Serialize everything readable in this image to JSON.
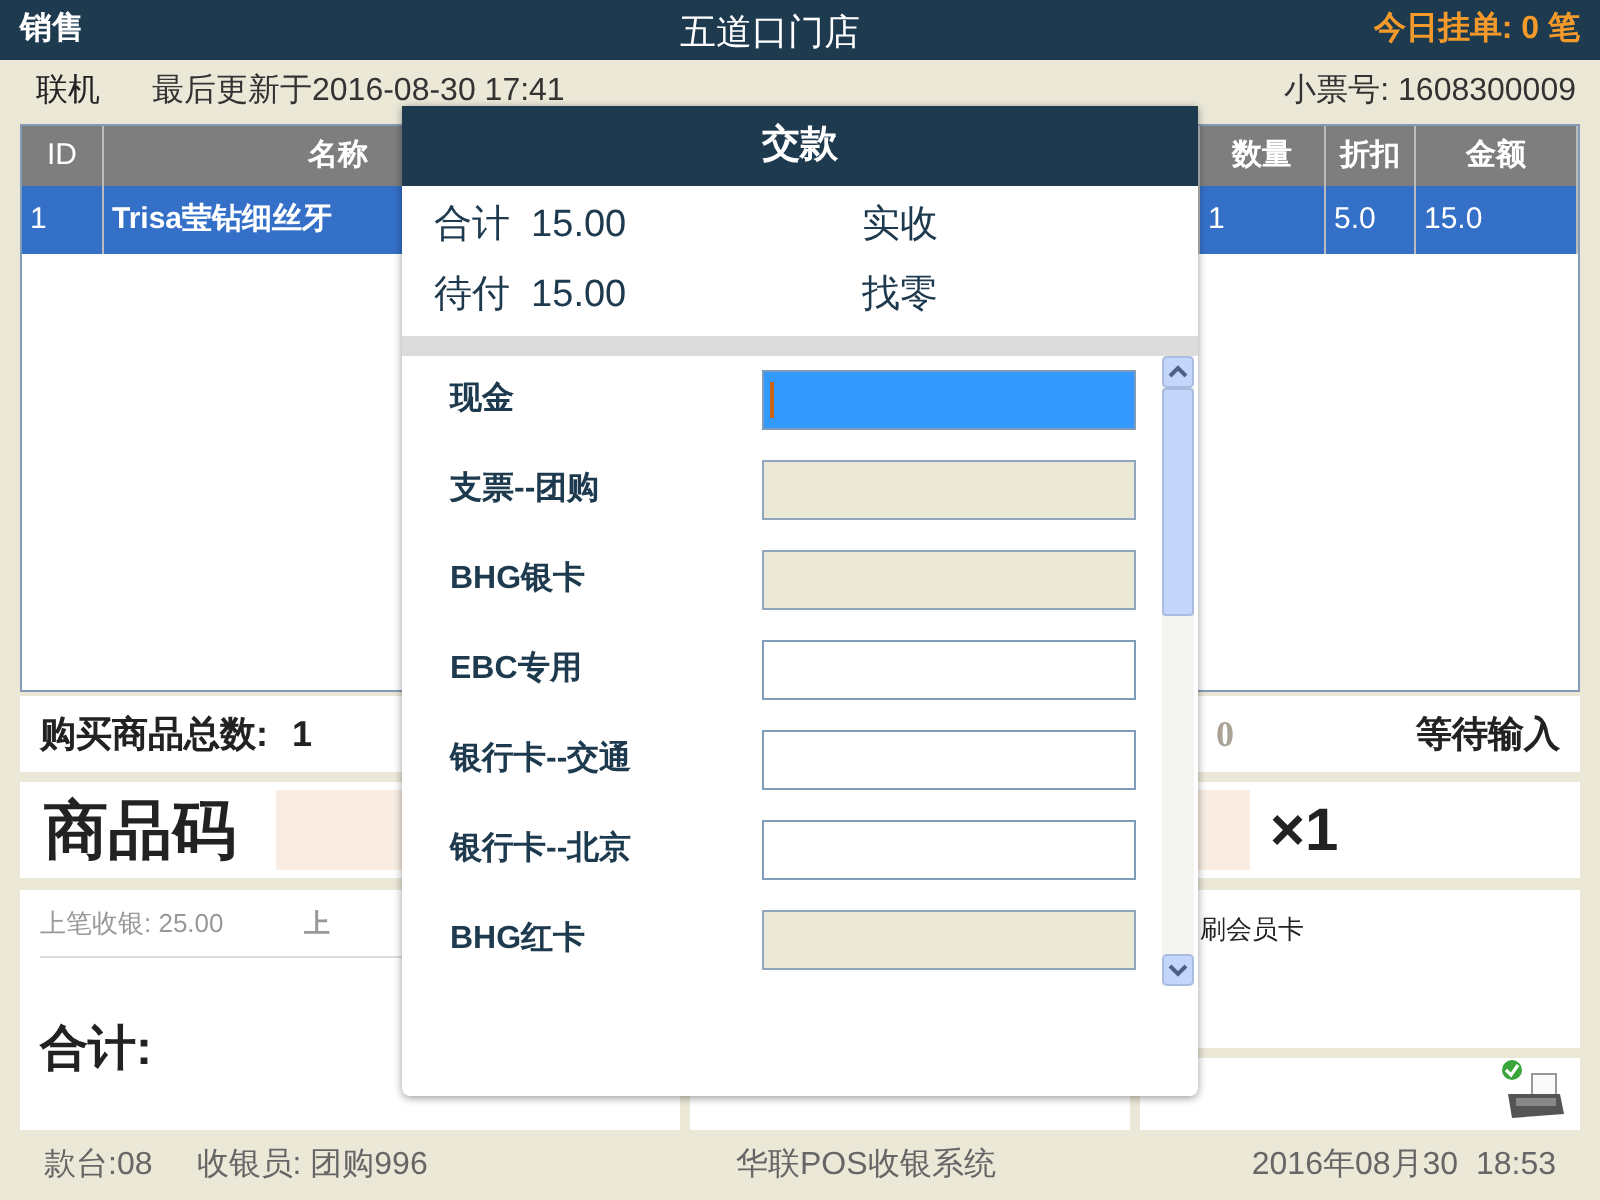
{
  "header": {
    "mode": "销售",
    "store": "五道口门店",
    "pending": "今日挂单: 0 笔"
  },
  "info_bar": {
    "connection": "联机",
    "last_update": "最后更新于2016-08-30 17:41",
    "receipt_no": "小票号: 1608300009"
  },
  "table": {
    "columns": [
      "ID",
      "名称",
      "数量",
      "折扣",
      "金额"
    ],
    "rows": [
      {
        "selected": true,
        "cells": [
          "1",
          "Trisa莹钻细丝牙",
          "1",
          "5.0",
          "15.0"
        ]
      }
    ]
  },
  "summary": {
    "total_items_label": "购买商品总数:",
    "total_items": "1",
    "amount_tail": "0",
    "status": "等待输入"
  },
  "barcode": {
    "label": "商品码",
    "quantity": "×1"
  },
  "last_sale": {
    "label": "上笔收银: 25.00",
    "next_label": "上"
  },
  "member": {
    "hint": "刷会员卡"
  },
  "total": {
    "label": "合计:"
  },
  "printer": {
    "ready": true
  },
  "payment_dialog": {
    "title": "交款",
    "total": "合计  15.00",
    "received": "实收",
    "due": "待付  15.00",
    "change": "找零",
    "methods": [
      {
        "label": "现金",
        "selected": true,
        "disabled": false
      },
      {
        "label": "支票--团购",
        "selected": false,
        "disabled": true
      },
      {
        "label": "BHG银卡",
        "selected": false,
        "disabled": true
      },
      {
        "label": "EBC专用",
        "selected": false,
        "disabled": false
      },
      {
        "label": "银行卡--交通",
        "selected": false,
        "disabled": false
      },
      {
        "label": "银行卡--北京",
        "selected": false,
        "disabled": false
      },
      {
        "label": "BHG红卡",
        "selected": false,
        "disabled": true
      }
    ]
  },
  "status_bar": {
    "counter": "款台:08",
    "cashier": "收银员: 团购996",
    "system": "华联POS收银系统",
    "datetime": "2016年08月30  18:53"
  }
}
